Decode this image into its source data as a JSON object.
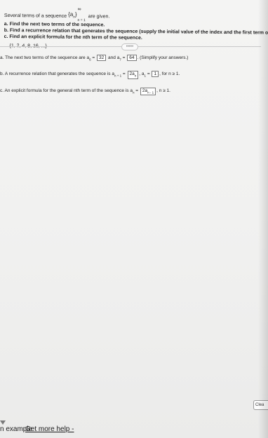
{
  "question": {
    "intro_before": "Several terms of a sequence",
    "notation_base": "{a",
    "notation_sub": "n",
    "notation_close": "}",
    "notation_sup": "∞",
    "notation_lower": "n = 1",
    "intro_after": "are given.",
    "part_a": "a. Find the next two terms of the sequence.",
    "part_b": "b. Find a recurrence relation that generates the sequence (supply the initial value of the index and the first term of the sequence).",
    "part_c": "c. Find an explicit formula for the nth term of the sequence.",
    "given_sequence": "{1, 2, 4, 8, 16, ...}"
  },
  "expand_pill": "•••••",
  "answers": {
    "a_text_1": "a. The next two terms of the sequence are a",
    "a_sub_6": "6",
    "a_text_eq1": " = ",
    "a_value_1": "32",
    "a_text_and": " and a",
    "a_sub_7": "7",
    "a_text_eq2": " = ",
    "a_value_2": "64",
    "a_text_end": ". (Simplify your answers.)",
    "b_text_1": "b. A recurrence relation that generates the sequence is a",
    "b_sub_n1": "n + 1",
    "b_text_eq": " = ",
    "b_value_1": "2a",
    "b_value_1_sub": "n",
    "b_text_mid": ", a",
    "b_sub_1": "1",
    "b_text_eq2": " = ",
    "b_value_2": "1",
    "b_text_end": ", for n ≥ 1.",
    "c_text_1": "c. An explicit formula for the general nth term of the sequence is a",
    "c_sub_n": "n",
    "c_text_eq": " = ",
    "c_value": "2a",
    "c_value_sub": "n - 1",
    "c_text_end": ", n ≥ 1."
  },
  "footer": {
    "example_label": "n example",
    "help_label": "Get more help -"
  },
  "clear_button": "Clea"
}
